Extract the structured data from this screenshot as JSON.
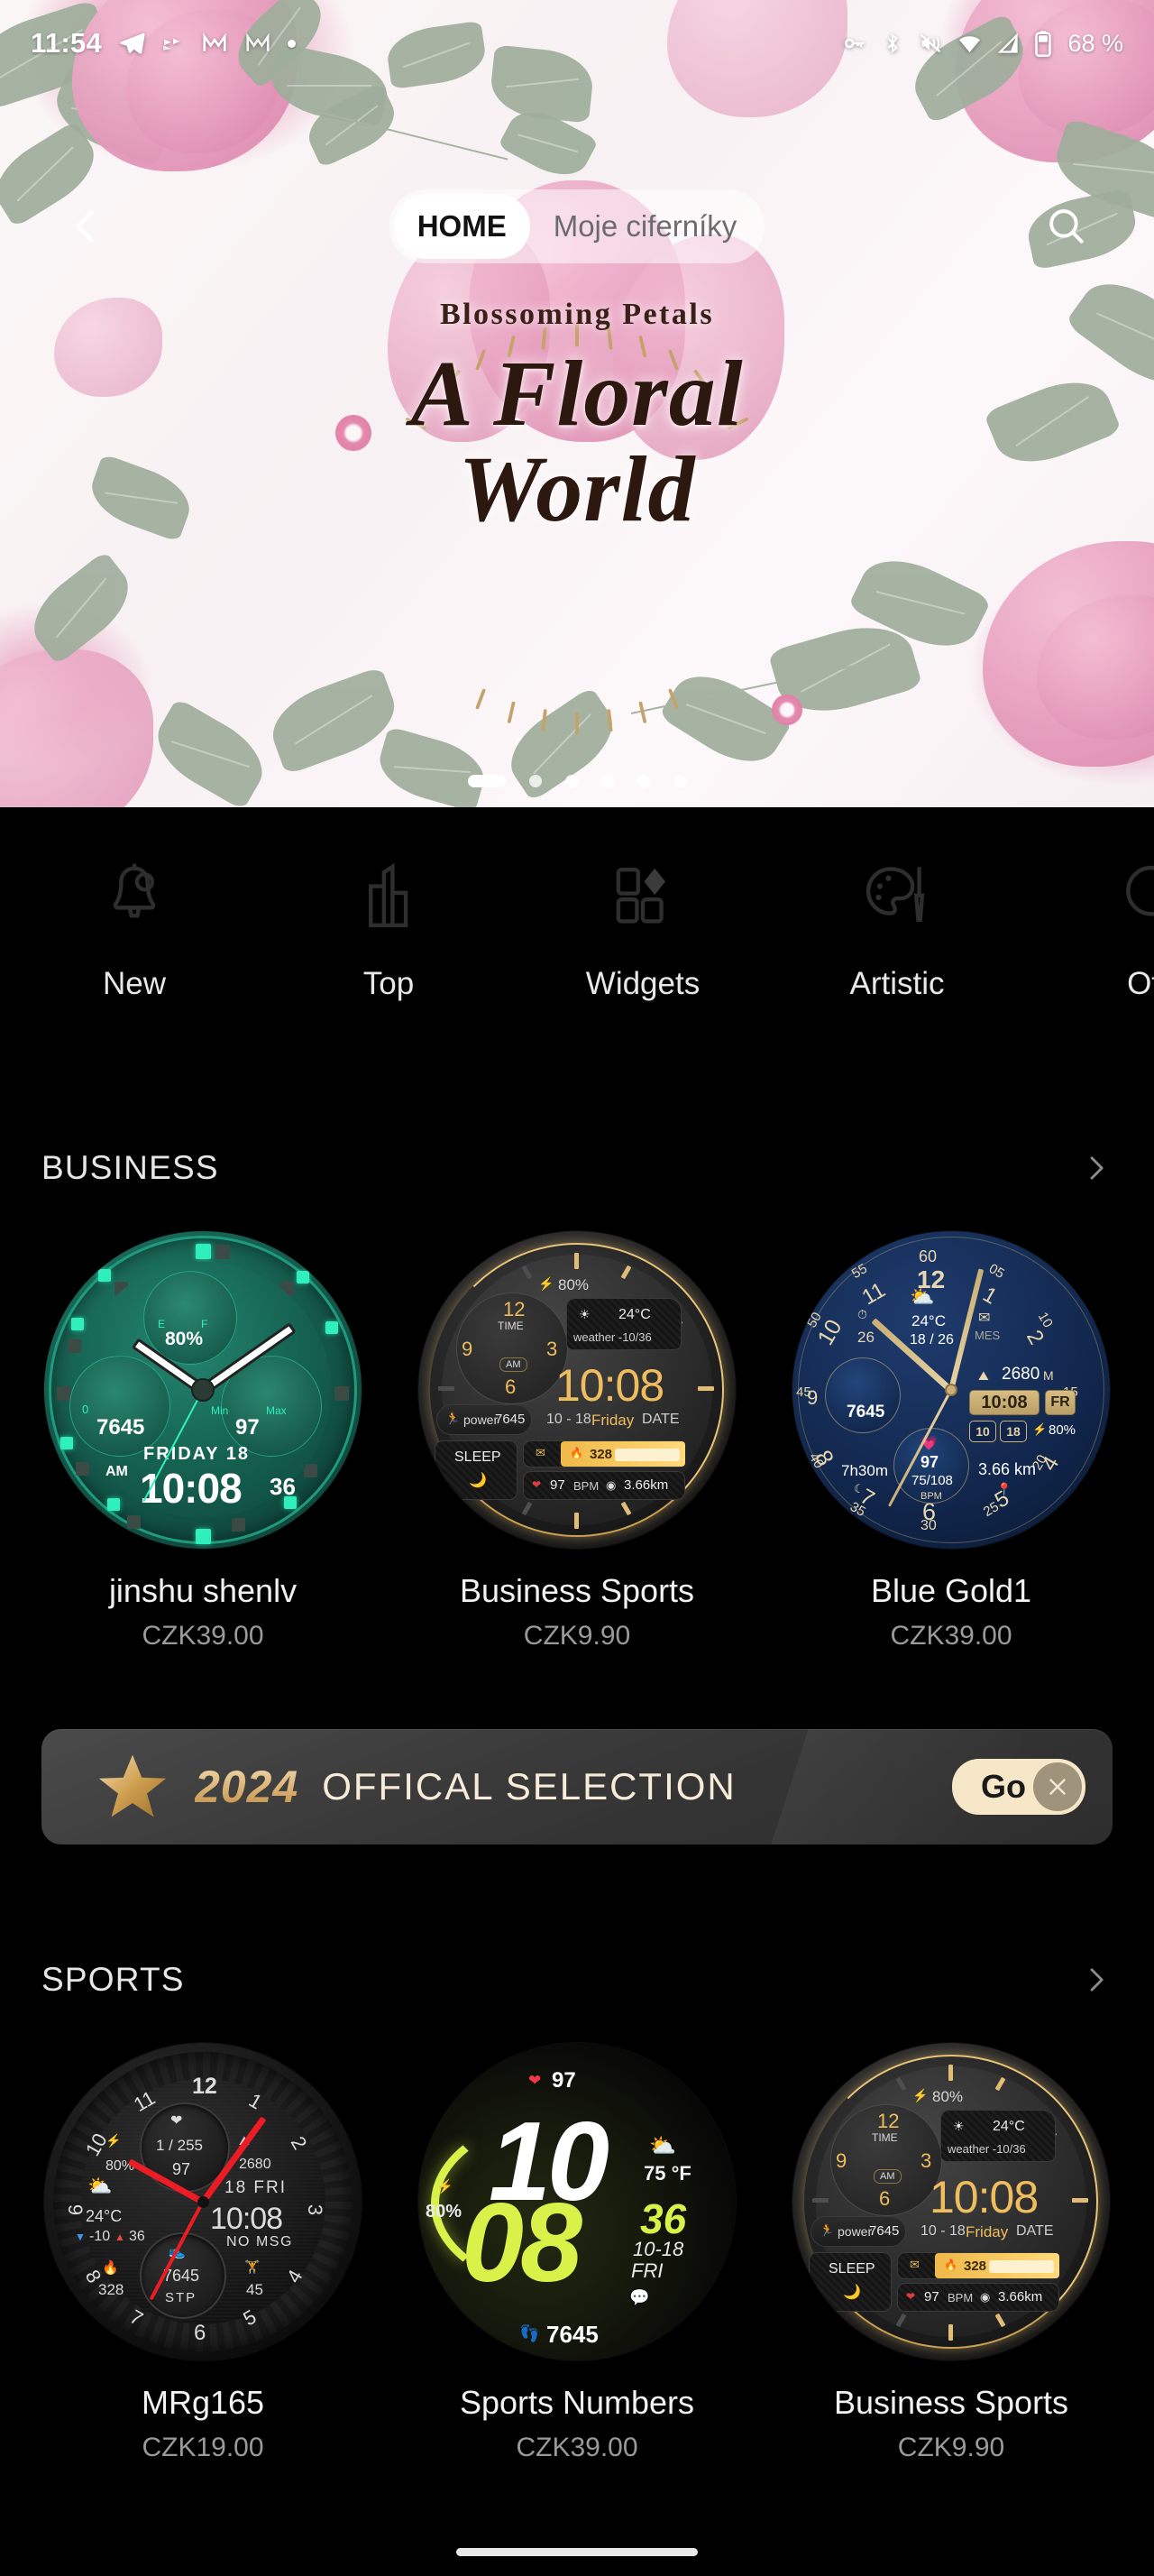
{
  "status_bar": {
    "time": "11:54",
    "battery_percent": "68 %",
    "left_icons": [
      "telegram-icon",
      "vibrate-icon",
      "gmail-icon",
      "gmail-icon",
      "dot-indicator-icon"
    ],
    "right_icons": [
      "vpn-key-icon",
      "bluetooth-icon",
      "mute-icon",
      "wifi-icon",
      "cellular-signal-icon",
      "battery-icon"
    ]
  },
  "header": {
    "back_label": "back-arrow",
    "search_label": "search",
    "tabs": [
      {
        "label": "HOME",
        "active": true
      },
      {
        "label": "Moje ciferníky",
        "active": false
      }
    ]
  },
  "banner": {
    "subtitle": "Blossoming Petals",
    "title_line1": "A Floral",
    "title_line2": "World",
    "dots_total": 6,
    "dots_active_index": 0
  },
  "categories": [
    {
      "label": "New",
      "icon": "bell-icon"
    },
    {
      "label": "Top",
      "icon": "bar-chart-icon"
    },
    {
      "label": "Widgets",
      "icon": "widgets-icon"
    },
    {
      "label": "Artistic",
      "icon": "palette-icon"
    },
    {
      "label": "Offi",
      "icon": "official-icon"
    }
  ],
  "sections": [
    {
      "title": "BUSINESS",
      "arrow": "chevron-right-icon",
      "cards": [
        {
          "name": "jinshu shenlv",
          "price": "CZK39.00",
          "face": "green"
        },
        {
          "name": "Business Sports",
          "price": "CZK9.90",
          "face": "gold"
        },
        {
          "name": "Blue Gold1",
          "price": "CZK39.00",
          "face": "blue"
        }
      ]
    },
    {
      "title": "SPORTS",
      "arrow": "chevron-right-icon",
      "cards": [
        {
          "name": "MRg165",
          "price": "CZK19.00",
          "face": "mrg"
        },
        {
          "name": "Sports Numbers",
          "price": "CZK39.00",
          "face": "numbers"
        },
        {
          "name": "Business Sports",
          "price": "CZK9.90",
          "face": "gold"
        }
      ]
    }
  ],
  "promo": {
    "year": "2024",
    "text": "OFFICAL SELECTION",
    "go_label": "Go",
    "close_icon": "close-icon",
    "star_icon": "star-icon"
  },
  "watch_faces": {
    "green": {
      "battery": "80%",
      "steps": "7645",
      "bpm": "97",
      "weekday_date": "FRIDAY  18",
      "time": "10:08",
      "seconds": "36",
      "ampm": "AM",
      "gauge_left": "E",
      "gauge_right": "F",
      "sub_left_min": "0",
      "sub_right_min": "Min",
      "sub_right_max": "Max"
    },
    "gold": {
      "battery": "80%",
      "sub_label": "TIME",
      "sub_ampm": "AM",
      "sub_nums": [
        "12",
        "3",
        "6",
        "9"
      ],
      "weather_temp": "24°C",
      "weather_range": "weather -10/36",
      "time": "10:08",
      "date": "10 - 18",
      "weekday": "Friday",
      "date_label": "DATE",
      "power_label": "power",
      "power_value": "7645",
      "sleep_label": "SLEEP",
      "calories": "328",
      "bpm": "97",
      "bpm_label": "BPM",
      "distance": "3.66km"
    },
    "blue": {
      "hour_nums": [
        "12",
        "1",
        "2",
        "3",
        "4",
        "5",
        "6",
        "7",
        "8",
        "9",
        "10",
        "11"
      ],
      "minute_nums": [
        "60",
        "05",
        "10",
        "15",
        "20",
        "25",
        "30",
        "35",
        "40",
        "45",
        "50",
        "55"
      ],
      "timer": "26",
      "weather_temp": "24°C",
      "weather_range": "18 / 26",
      "msg_label": "MES",
      "altitude": "2680",
      "altitude_unit": "M",
      "time": "10:08",
      "weekday": "FR",
      "date_month": "10",
      "date_day": "18",
      "battery": "80%",
      "steps": "7645",
      "sleep": "7h30m",
      "bpm": "97",
      "bpm_range": "75/108",
      "bpm_label": "BPM",
      "distance": "3.66 km"
    },
    "mrg": {
      "hour_nums": [
        "12",
        "1",
        "2",
        "3",
        "4",
        "5",
        "6",
        "7",
        "8",
        "9",
        "10",
        "11"
      ],
      "battery": "80%",
      "hr_range": "1 / 255",
      "bpm": "97",
      "altitude": "2680",
      "date": "18  FRI",
      "time": "10:08",
      "msg": "NO MSG",
      "weather_temp": "24°C",
      "weather_low": "-10",
      "weather_high": "36",
      "calories": "328",
      "steps": "7645",
      "steps_label": "STP",
      "activity": "45"
    },
    "numbers": {
      "bpm": "97",
      "hour": "10",
      "minute": "08",
      "battery": "80%",
      "weather_temp": "75 °F",
      "seconds": "36",
      "date": "10-18",
      "weekday": "FRI",
      "steps": "7645"
    }
  },
  "colors": {
    "background": "#000000",
    "accent_gold": "#e8c478",
    "accent_green": "#d8f24a",
    "accent_red": "#ec1c24",
    "text_primary": "#f2f2f2",
    "text_secondary": "#9a9a9a"
  }
}
